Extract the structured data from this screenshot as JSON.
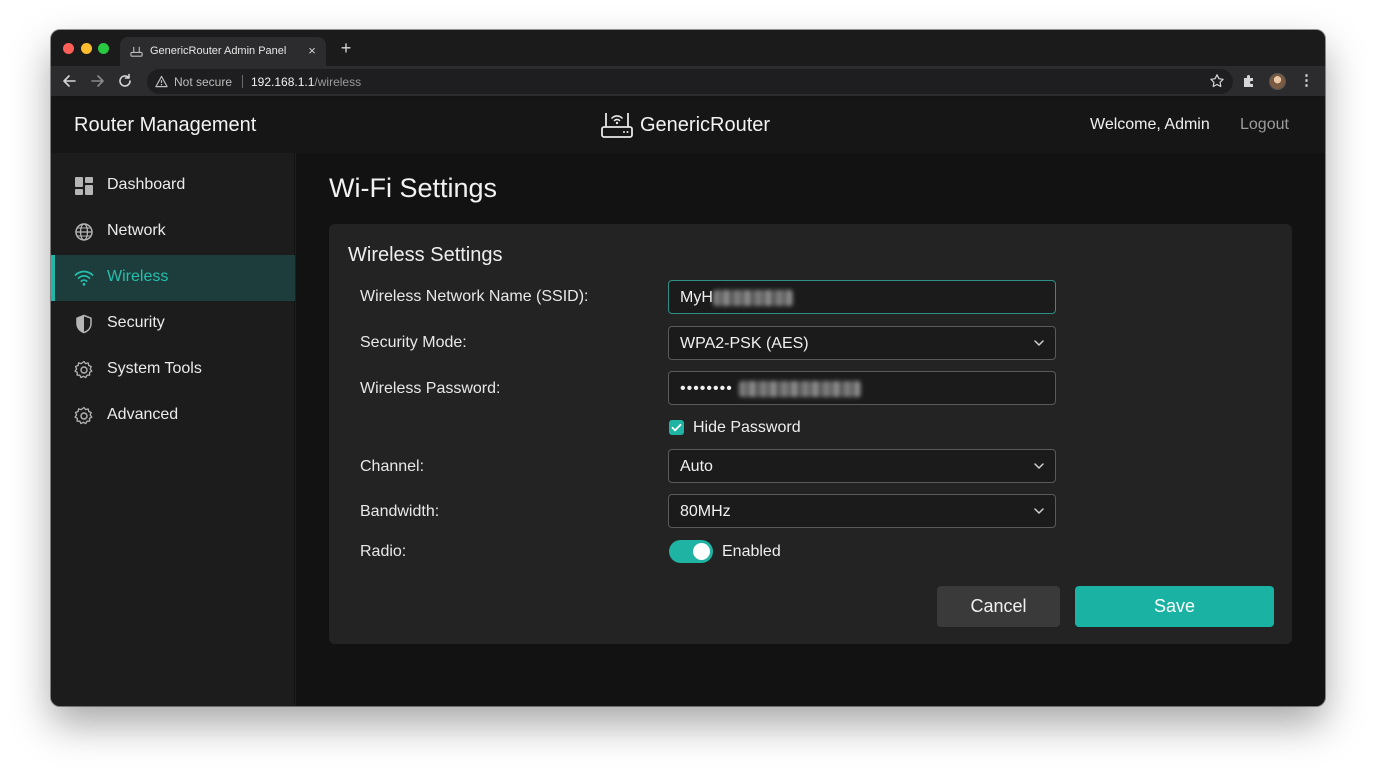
{
  "browser": {
    "tab_title": "GenericRouter Admin Panel",
    "tab_close": "×",
    "new_tab": "+",
    "security_label": "Not secure",
    "url_host": "192.168.1.1",
    "url_path": "/wireless",
    "icons": [
      "back-icon",
      "forward-icon",
      "reload-icon",
      "warning-icon",
      "star-icon",
      "extensions-icon",
      "profile-avatar",
      "menu-icon"
    ]
  },
  "header": {
    "app_title": "Router Management",
    "brand_name": "GenericRouter",
    "welcome": "Welcome, Admin",
    "logout": "Logout"
  },
  "sidebar": {
    "items": [
      {
        "label": "Dashboard",
        "icon": "dashboard-icon"
      },
      {
        "label": "Network",
        "icon": "globe-icon"
      },
      {
        "label": "Wireless",
        "icon": "wifi-icon",
        "active": true
      },
      {
        "label": "Security",
        "icon": "shield-icon"
      },
      {
        "label": "System Tools",
        "icon": "gear-icon"
      },
      {
        "label": "Advanced",
        "icon": "gear-icon"
      }
    ]
  },
  "page": {
    "title": "Wi-Fi Settings",
    "section_title": "Wireless Settings",
    "fields": {
      "ssid_label": "Wireless Network Name (SSID):",
      "ssid_value": "MyH",
      "security_label": "Security Mode:",
      "security_value": "WPA2-PSK (AES)",
      "password_label": "Wireless Password:",
      "password_value": "••••••••",
      "hide_password_label": "Hide Password",
      "hide_password_checked": true,
      "channel_label": "Channel:",
      "channel_value": "Auto",
      "bandwidth_label": "Bandwidth:",
      "bandwidth_value": "80MHz",
      "radio_label": "Radio:",
      "radio_state": "Enabled",
      "radio_on": true
    },
    "buttons": {
      "cancel": "Cancel",
      "save": "Save"
    }
  },
  "colors": {
    "accent": "#1fb3a3",
    "active_nav_bg": "#1c3d3b",
    "background": "#121212",
    "card": "#232323"
  }
}
